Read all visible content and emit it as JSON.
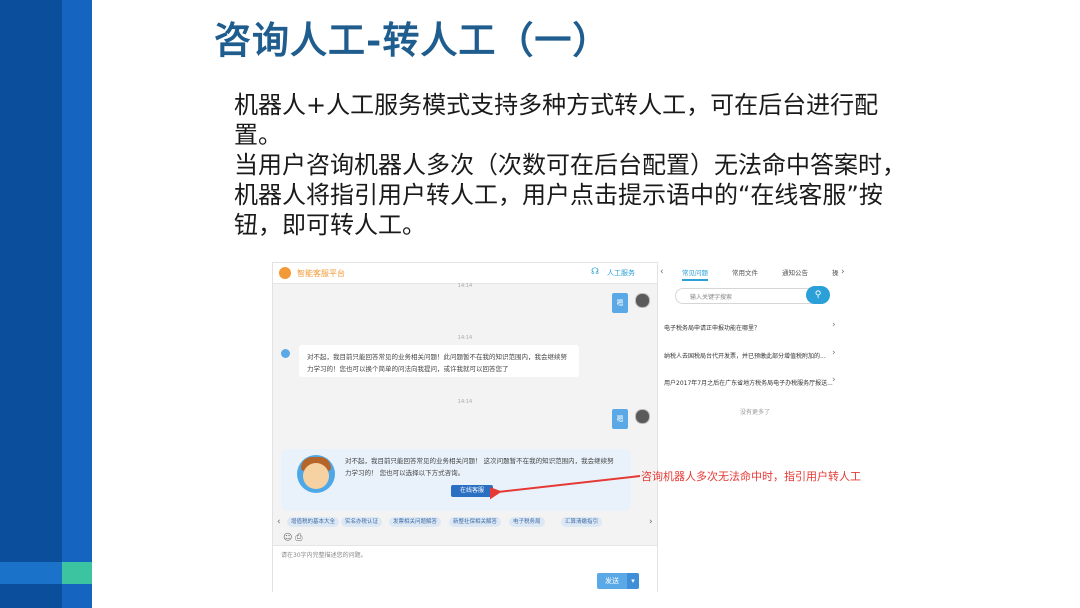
{
  "slide": {
    "title": "咨询人工-转人工（一）",
    "body": [
      "机器人+人工服务模式支持多种方式转人工，可在后台进行配置。",
      "当用户咨询机器人多次（次数可在后台配置）无法命中答案时，机器人将指引用户转人工，用户点击提示语中的“在线客服”按钮，即可转人工。"
    ]
  },
  "chat": {
    "app_title": "智能客服平台",
    "human_service": "人工服务",
    "timestamps": [
      "14:14",
      "14:14",
      "14:14"
    ],
    "user_msg_1": "嗯",
    "bot_msg_1": "对不起，我目前只能回答常见的业务相关问题！此问题暂不在我的知识范围内，我会继续努力学习的！您也可以换个简单的问法向我提问，或许我就可以回答您了",
    "user_msg_2": "嗯",
    "prompt_text": "对不起，我目前只能回答常见的业务相关问题！ 这次问题暂不在我的知识范围内，我会继续努力学习的！ 您也可以选择以下方式咨询。",
    "online_button": "在线客服",
    "quick_questions": [
      "增值税的基本大全",
      "实名办税认证",
      "发票相关问题解答",
      "新整社保相关解答",
      "电子税务局",
      "汇算清缴指引"
    ],
    "input_placeholder": "请在30字内完整描述您的问题。",
    "send_button": "发送",
    "send_dropdown": "▾"
  },
  "right_panel": {
    "tabs": [
      "常见问题",
      "常用文件",
      "通知公告",
      "操"
    ],
    "search_placeholder": "输入关键字搜索",
    "items": [
      "电子税务局申请正申报功能在哪里？",
      "纳税人去国税局台代开发票，并已预缴此部分增值税附加的...",
      "用户2017年7月之后在广东省地方税务局电子办税服务厅报送..."
    ],
    "more": "没有更多了"
  },
  "annotation": "咨询机器人多次无法命中时，指引用户转人工",
  "colors": {
    "sidebar_dark": "#0b4f9c",
    "sidebar_light": "#1565c0",
    "accent_green": "#3cc4a0",
    "title": "#1f5d8f",
    "annotation_red": "#e53935",
    "brand_orange": "#f29a38",
    "link_blue": "#2a9fd8"
  },
  "icons": {
    "headset": "headset-icon",
    "search": "search-icon",
    "emoji": "emoji-icon",
    "attach": "attachment-icon"
  }
}
